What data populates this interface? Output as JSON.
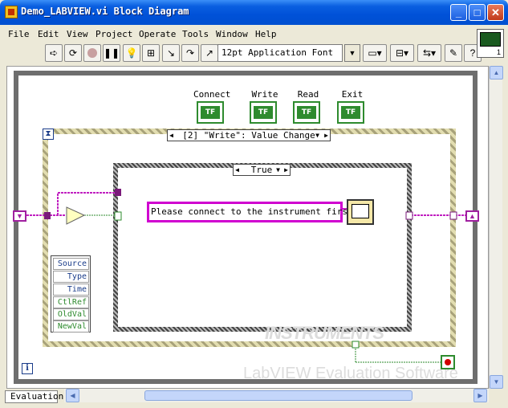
{
  "window": {
    "title": "Demo_LABVIEW.vi Block Diagram",
    "controls": [
      "_",
      "□",
      "✕"
    ]
  },
  "menu": [
    {
      "label": "File"
    },
    {
      "label": "Edit"
    },
    {
      "label": "View"
    },
    {
      "label": "Project"
    },
    {
      "label": "Operate"
    },
    {
      "label": "Tools"
    },
    {
      "label": "Window"
    },
    {
      "label": "Help"
    }
  ],
  "toolbar": {
    "font": "12pt Application Font",
    "buttons": [
      "run-arrow-icon",
      "run-continuous-icon",
      "abort-icon",
      "pause-icon",
      "highlight-execution-icon",
      "retain-wire-values-icon",
      "step-into-icon",
      "step-over-icon",
      "step-out-icon",
      "align-icon",
      "distribute-icon",
      "reorder-icon",
      "cleanup-icon",
      "help-icon"
    ]
  },
  "connector_pane": {
    "number": "1"
  },
  "terminals": [
    {
      "label": "Connect",
      "type": "TF"
    },
    {
      "label": "Write",
      "type": "TF"
    },
    {
      "label": "Read",
      "type": "TF"
    },
    {
      "label": "Exit",
      "type": "TF"
    }
  ],
  "event_structure": {
    "selector": "[2] \"Write\": Value Change",
    "event_data": [
      "Source",
      "Type",
      "Time",
      "CtlRef",
      "OldVal",
      "NewVal"
    ]
  },
  "case_structure": {
    "selector": "True"
  },
  "message": "Please connect to the instrument first!",
  "status": {
    "tab": "Evaluation",
    "iteration_icon": "i"
  },
  "watermark": {
    "line1": "INSTRUMENTS",
    "line2": "LabVIEW Evaluation Software"
  },
  "colors": {
    "titlebar": "#0a5fe0",
    "boolean_wire": "#2e8b2e",
    "refnum_wire": "#c020c0"
  }
}
